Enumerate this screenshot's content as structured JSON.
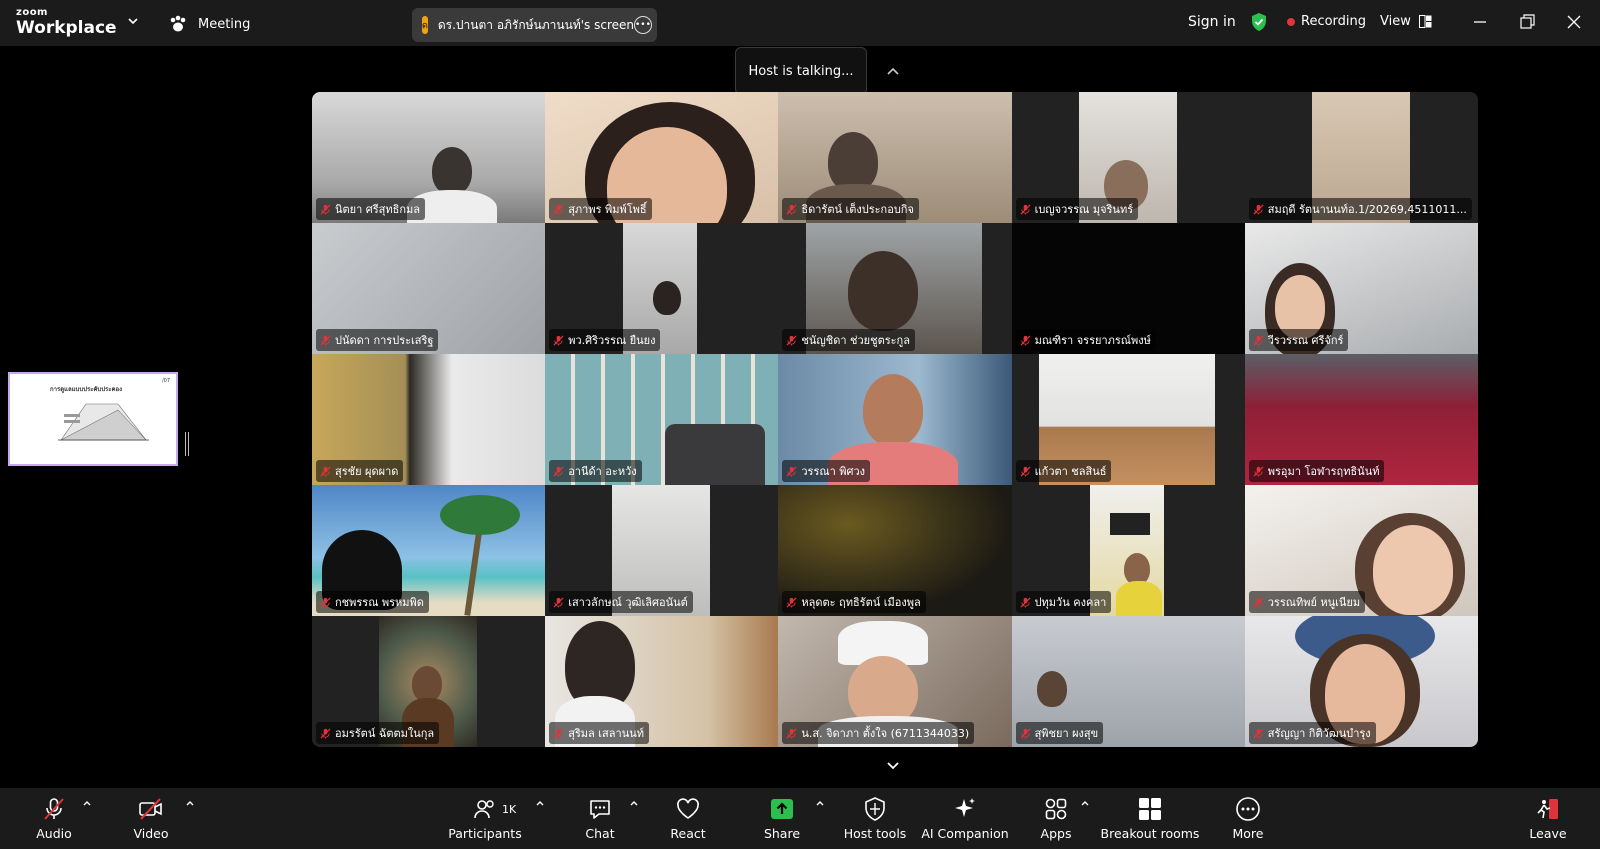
{
  "app": {
    "brand_small": "zoom",
    "brand_big": "Workplace",
    "meeting_label": "Meeting"
  },
  "share": {
    "initial": "ด",
    "label": "ดร.ปานตา อภิรักษ์นภานนท์'s screen"
  },
  "header": {
    "sign_in": "Sign in",
    "recording": "Recording",
    "view": "View"
  },
  "status": {
    "host_talking": "Host is talking..."
  },
  "slide": {
    "title": "การดูแลแบบประคับประคอง",
    "page": "/07"
  },
  "participants": [
    {
      "name": "นิตยา ศรีสุทธิกมล"
    },
    {
      "name": "สุภาพร พิมพ์โพธิ์"
    },
    {
      "name": "ธิดารัตน์ เต็งประกอบกิจ"
    },
    {
      "name": "เบญจวรรณ มุจรินทร์"
    },
    {
      "name": "สมฤดี รัตนานนท์อ.1/20269,4511011..."
    },
    {
      "name": "ปนัดดา การประเสริฐ"
    },
    {
      "name": "พว.ศิริวรรณ ยืนยง"
    },
    {
      "name": "ชนัญชิดา ช่วยชูตระกูล"
    },
    {
      "name": "มณฑิรา จรรยาภรณ์พงษ์"
    },
    {
      "name": "วีรวรรณ ศรีจักร์"
    },
    {
      "name": "สุรชัย ผุดผาด"
    },
    {
      "name": "อานีด้า อะหวัง"
    },
    {
      "name": "วรรณา พิศวง"
    },
    {
      "name": "แก้วตา ชลสินธ์"
    },
    {
      "name": "พรอุมา โอฬารฤทธินันท์"
    },
    {
      "name": "กชพรรณ พรหมพิด"
    },
    {
      "name": "เสาวลักษณ์ วุฒิเลิศอนันต์"
    },
    {
      "name": "หลุดตะ ฤทธิรัตน์ เมืองพูล"
    },
    {
      "name": "ปทุมวัน คงคลา"
    },
    {
      "name": "วรรณทิพย์ หนูเนียม"
    },
    {
      "name": "อมรรัตน์ ฉัตตมในกุล"
    },
    {
      "name": "สุริมล เสลานนท์"
    },
    {
      "name": "น.ส. จิดาภา ตั้งใจ (6711344033)"
    },
    {
      "name": "สุพิชยา ผงสุข"
    },
    {
      "name": "สรัญญา กิติวัฒนบำรุง"
    }
  ],
  "toolbar": {
    "audio": "Audio",
    "video": "Video",
    "participants": "Participants",
    "participants_count": "1K",
    "chat": "Chat",
    "react": "React",
    "share": "Share",
    "host_tools": "Host tools",
    "ai_companion": "AI Companion",
    "apps": "Apps",
    "breakout_rooms": "Breakout rooms",
    "more": "More",
    "leave": "Leave"
  },
  "colors": {
    "accent_green": "#2bbf4e",
    "recording_red": "#e0343b",
    "leave_red": "#e0343b",
    "share_orange": "#f2a30f"
  }
}
